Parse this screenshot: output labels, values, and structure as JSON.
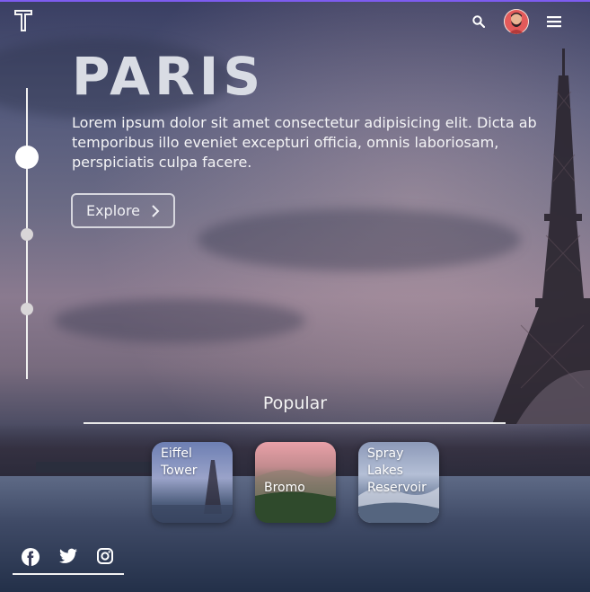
{
  "hero": {
    "title": "PARIS",
    "description": "Lorem ipsum dolor sit amet consectetur adipisicing elit. Dicta ab temporibus illo eveniet excepturi officia, omnis laboriosam, perspiciatis culpa facere.",
    "explore_label": "Explore"
  },
  "header": {
    "logo_icon": "t-logo-icon",
    "search_icon": "search-icon",
    "avatar_icon": "avatar",
    "menu_icon": "hamburger-menu-icon"
  },
  "slider": {
    "dots": 3,
    "active_index": 0
  },
  "popular": {
    "heading": "Popular",
    "cards": [
      {
        "label_line1": "Eiffel",
        "label_line2": "Tower"
      },
      {
        "label_line1": "Bromo"
      },
      {
        "label_line1": "Spray",
        "label_line2": "Lakes",
        "label_line3": "Reservoir"
      }
    ]
  },
  "social": [
    "facebook-icon",
    "twitter-icon",
    "instagram-icon"
  ],
  "colors": {
    "accent_top_border": "#7d5cf0",
    "text": "#ffffff"
  }
}
